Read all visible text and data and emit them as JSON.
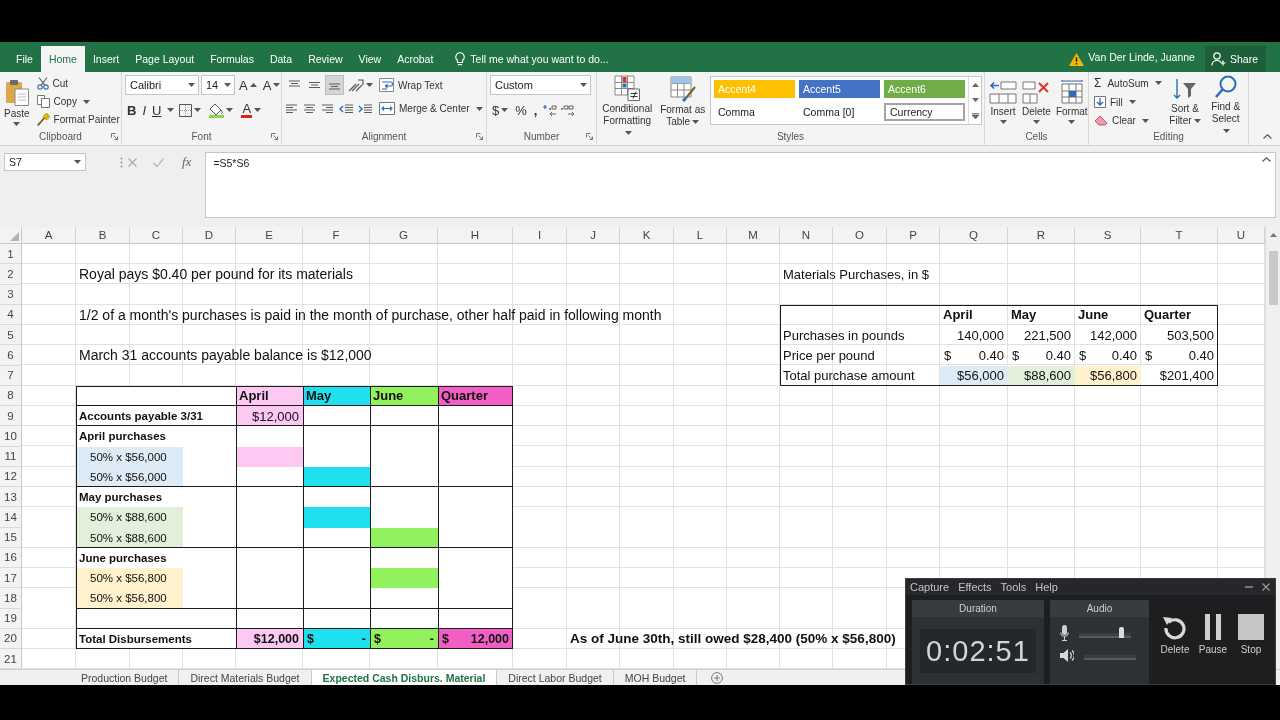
{
  "ribbon_tabs": [
    {
      "label": "File",
      "selected": false
    },
    {
      "label": "Home",
      "selected": true
    },
    {
      "label": "Insert",
      "selected": false
    },
    {
      "label": "Page Layout",
      "selected": false
    },
    {
      "label": "Formulas",
      "selected": false
    },
    {
      "label": "Data",
      "selected": false
    },
    {
      "label": "Review",
      "selected": false
    },
    {
      "label": "View",
      "selected": false
    },
    {
      "label": "Acrobat",
      "selected": false
    }
  ],
  "tell_me": {
    "placeholder": "Tell me what you want to do..."
  },
  "account": {
    "name": "Van Der Linde, Juanne",
    "share": "Share"
  },
  "ribbon": {
    "clipboard": {
      "label": "Clipboard",
      "paste": "Paste",
      "cut": "Cut",
      "copy": "Copy",
      "format_painter": "Format Painter"
    },
    "font": {
      "label": "Font",
      "font_name": "Calibri",
      "font_size": "14",
      "grow": "A",
      "shrink": "A",
      "bold": "B",
      "italic": "I",
      "underline": "U",
      "font_color": "A"
    },
    "alignment": {
      "label": "Alignment",
      "vertical_align": [
        {
          "kind": "top",
          "selected": false
        },
        {
          "kind": "middle",
          "selected": false
        },
        {
          "kind": "bottom",
          "selected": true
        }
      ],
      "wrap_text": "Wrap Text",
      "merge_center": "Merge & Center"
    },
    "number": {
      "label": "Number",
      "format": "Custom",
      "currency": "$",
      "percent": "%",
      "comma": ","
    },
    "styles": {
      "label": "Styles",
      "conditional": "Conditional Formatting",
      "format_table": "Format as Table",
      "gallery": [
        {
          "label": "Accent4",
          "color": "#ffc000",
          "selected": false
        },
        {
          "label": "Accent5",
          "color": "#4472c4",
          "selected": false
        },
        {
          "label": "Accent6",
          "color": "#70ad47",
          "selected": false
        },
        {
          "label": "Comma",
          "selected": false
        },
        {
          "label": "Comma [0]",
          "selected": false
        },
        {
          "label": "Currency",
          "selected": true
        }
      ]
    },
    "cells": {
      "label": "Cells",
      "buttons": [
        {
          "kind": "insert",
          "label": "Insert"
        },
        {
          "kind": "delete",
          "label": "Delete"
        },
        {
          "kind": "format",
          "label": "Format"
        }
      ]
    },
    "editing": {
      "label": "Editing",
      "autosum_symbol": "Σ",
      "autosum": "AutoSum",
      "fill": "Fill",
      "clear": "Clear",
      "sort_filter": "Sort & Filter",
      "find_select": "Find & Select"
    }
  },
  "formula_bar": {
    "name_box": "S7",
    "function_label": "fx",
    "formula": "=S5*S6"
  },
  "sheet": {
    "columns": [
      "A",
      "B",
      "C",
      "D",
      "E",
      "F",
      "G",
      "H",
      "I",
      "J",
      "K",
      "L",
      "M",
      "N",
      "O",
      "P",
      "Q",
      "R",
      "S",
      "T",
      "U"
    ],
    "rows": [
      "1",
      "2",
      "3",
      "4",
      "5",
      "6",
      "7",
      "8",
      "9",
      "10",
      "11",
      "12",
      "13",
      "14",
      "15",
      "16",
      "17",
      "18",
      "19",
      "20",
      "21"
    ]
  },
  "notes": [
    "Royal pays $0.40 per pound for its materials",
    "1/2 of a month's purchases is paid in the month of purchase, other half paid in following month",
    "March 31 accounts payable balance is $12,000"
  ],
  "purchases": {
    "title": "Materials Purchases, in $",
    "columns": [
      "April",
      "May",
      "June",
      "Quarter"
    ],
    "rows": [
      {
        "label": "Purchases in pounds",
        "values": [
          {
            "text": "140,000"
          },
          {
            "text": "221,500"
          },
          {
            "text": "142,000"
          },
          {
            "text": "503,500"
          }
        ]
      },
      {
        "label": "Price per pound",
        "values": [
          {
            "symbol": "$",
            "text": "0.40"
          },
          {
            "symbol": "$",
            "text": "0.40"
          },
          {
            "symbol": "$",
            "text": "0.40"
          },
          {
            "symbol": "$",
            "text": "0.40"
          }
        ]
      },
      {
        "label": "Total purchase amount",
        "values": [
          {
            "text": "$56,000",
            "color": "#ddebf7"
          },
          {
            "text": "$88,600",
            "color": "#e2efda"
          },
          {
            "text": "$56,800",
            "color": "#fff2cc"
          },
          {
            "text": "$201,400"
          }
        ]
      }
    ]
  },
  "disbursements": {
    "columns": [
      {
        "label": "April",
        "color": "#fdc8f2"
      },
      {
        "label": "May",
        "color": "#1fe0ee"
      },
      {
        "label": "June",
        "color": "#92f25e"
      },
      {
        "label": "Quarter",
        "color": "#f25fc4"
      }
    ],
    "opening": {
      "label": "Accounts payable 3/31",
      "values": [
        {
          "text": "$12,000"
        }
      ]
    },
    "sections": [
      {
        "label": "April purchases",
        "rows": [
          {
            "label": "50% x $56,000",
            "color": "#ddebf7",
            "paid": [
              true,
              false,
              false,
              false
            ]
          },
          {
            "label": "50% x $56,000",
            "color": "#ddebf7",
            "paid": [
              false,
              true,
              false,
              false
            ]
          }
        ]
      },
      {
        "label": "May purchases",
        "rows": [
          {
            "label": "50% x $88,600",
            "color": "#e2efda",
            "paid": [
              false,
              true,
              false,
              false
            ]
          },
          {
            "label": "50% x $88,600",
            "color": "#e2efda",
            "paid": [
              false,
              false,
              true,
              false
            ]
          }
        ]
      },
      {
        "label": "June purchases",
        "rows": [
          {
            "label": "50% x $56,800",
            "color": "#fff2cc",
            "paid": [
              false,
              false,
              true,
              false
            ]
          },
          {
            "label": "50% x $56,800",
            "color": "#fff2cc",
            "paid": [
              false,
              false,
              false,
              false
            ]
          }
        ]
      }
    ],
    "total": {
      "label": "Total Disbursements",
      "values": [
        {
          "text": "$12,000"
        },
        {
          "symbol": "$",
          "text": "-"
        },
        {
          "symbol": "$",
          "text": "-"
        },
        {
          "symbol": "$",
          "text": "12,000"
        }
      ]
    }
  },
  "remark": "As of June 30th, still owed $28,400 (50% x $56,800)",
  "sheet_tabs": [
    {
      "label": "Production Budget",
      "selected": false
    },
    {
      "label": "Direct Materials Budget",
      "selected": false
    },
    {
      "label": "Expected Cash Disburs. Material",
      "selected": true
    },
    {
      "label": "Direct Labor Budget",
      "selected": false
    },
    {
      "label": "MOH Budget",
      "selected": false
    }
  ],
  "recorder": {
    "menu": [
      "Capture",
      "Effects",
      "Tools",
      "Help"
    ],
    "duration_label": "Duration",
    "time": "0:02:51",
    "audio_label": "Audio",
    "mic": {
      "level": 0.8
    },
    "buttons": [
      {
        "kind": "delete",
        "label": "Delete"
      },
      {
        "kind": "pause",
        "label": "Pause"
      },
      {
        "kind": "stop",
        "label": "Stop"
      }
    ]
  }
}
